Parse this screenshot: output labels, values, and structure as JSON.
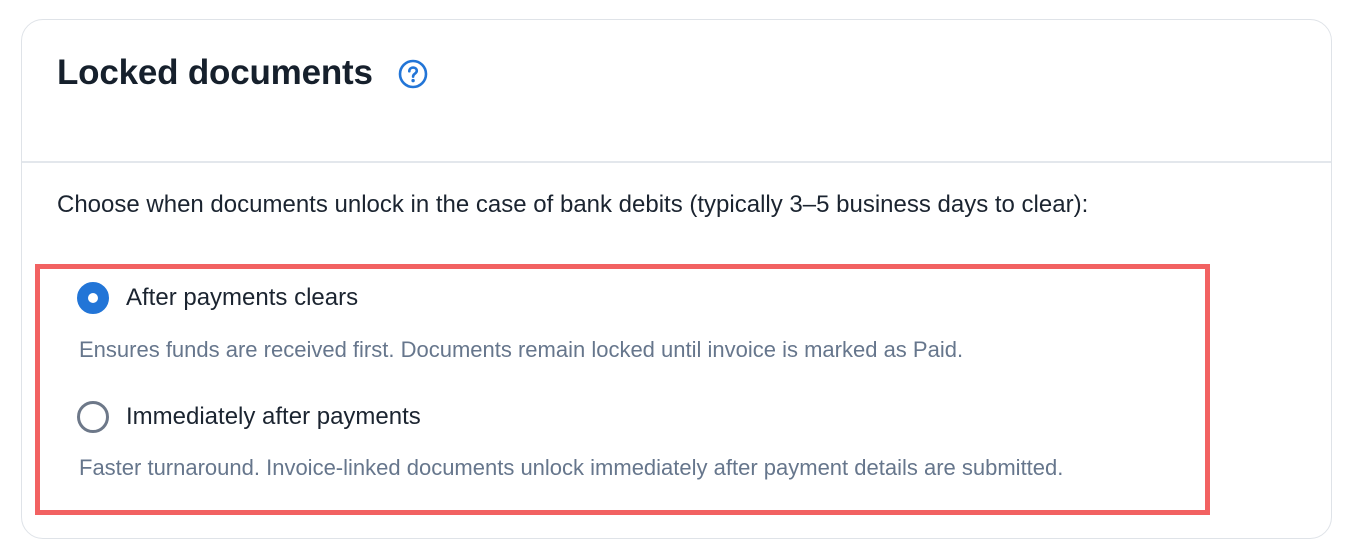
{
  "header": {
    "title": "Locked documents",
    "help_icon": "question-circle-icon",
    "accent_color": "#2275d7"
  },
  "intro": "Choose when documents unlock in the case of bank debits (typically 3–5 business days to clear):",
  "options": [
    {
      "label": "After payments clears",
      "description": "Ensures funds are received first. Documents remain locked until invoice is marked as Paid.",
      "selected": true
    },
    {
      "label": "Immediately after payments",
      "description": "Faster turnaround. Invoice-linked documents unlock immediately after payment details are submitted.",
      "selected": false
    }
  ],
  "highlight_color": "#f26262"
}
